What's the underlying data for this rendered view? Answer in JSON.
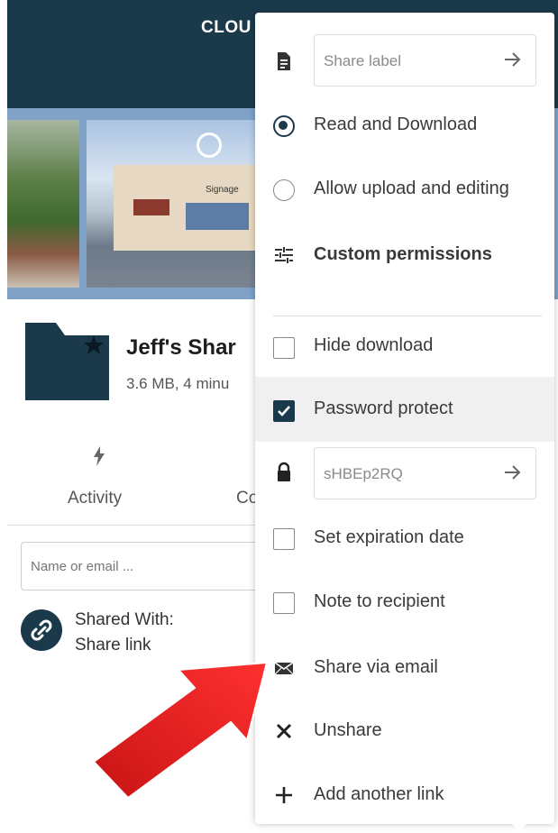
{
  "header": {
    "brand": "CLOU"
  },
  "banner": {
    "signage": "Signage"
  },
  "folder": {
    "title": "Jeff's Shar",
    "meta": "3.6 MB, 4 minu"
  },
  "tabs": {
    "activity": "Activity",
    "comments": "Co"
  },
  "search": {
    "placeholder": "Name or email ..."
  },
  "shared": {
    "with_label": "Shared With:",
    "link_label": "Share link"
  },
  "menu": {
    "share_label_placeholder": "Share label",
    "read_download": "Read and Download",
    "allow_upload": "Allow upload and editing",
    "custom_permissions": "Custom permissions",
    "hide_download": "Hide download",
    "password_protect": "Password protect",
    "password_value": "sHBEp2RQ",
    "set_expiration": "Set expiration date",
    "note_recipient": "Note to recipient",
    "share_email": "Share via email",
    "unshare": "Unshare",
    "add_link": "Add another link"
  },
  "state": {
    "permission": "read_and_download",
    "hide_download": false,
    "password_protect": true,
    "set_expiration": false,
    "note_to_recipient": false
  },
  "colors": {
    "primary": "#1a3a4c",
    "arrow": "#e02020",
    "highlight_row": "#f0f0f0"
  }
}
